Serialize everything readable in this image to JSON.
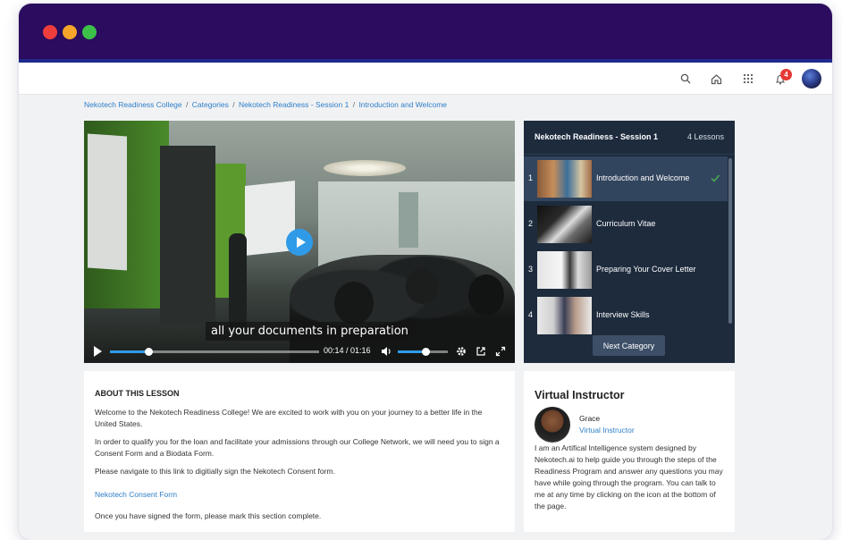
{
  "breadcrumb": {
    "items": [
      "Nekotech Readiness College",
      "Categories",
      "Nekotech Readiness - Session 1",
      "Introduction and Welcome"
    ],
    "separator": "/"
  },
  "navbar": {
    "icons": [
      "search-icon",
      "home-icon",
      "apps-grid-icon",
      "bell-icon"
    ],
    "notification_count": "4"
  },
  "video": {
    "caption": "all your documents in preparation",
    "time": "00:14 / 01:16",
    "progress": 0.184,
    "volume": 0.55
  },
  "lessons": {
    "title": "Nekotech Readiness - Session 1",
    "count": "4 Lessons",
    "items": [
      {
        "num": "1",
        "title": "Introduction and Welcome",
        "completed": true
      },
      {
        "num": "2",
        "title": "Curriculum Vitae",
        "completed": false
      },
      {
        "num": "3",
        "title": "Preparing Your Cover Letter",
        "completed": false
      },
      {
        "num": "4",
        "title": "Interview Skills",
        "completed": false
      }
    ],
    "next_label": "Next Category"
  },
  "about": {
    "title": "ABOUT THIS LESSON",
    "p1": "Welcome to the Nekotech Readiness College! We are excited to work with you on your journey to a better life in the United States.",
    "p2": "In order to qualify you for the loan and facilitate your admissions through our College Network, we will need you to sign a Consent Form and a Biodata Form.",
    "p3": "Please navigate to this link to digitially sign the Nekotech Consent form.",
    "link": "Nekotech Consent Form",
    "p4": "Once you have signed the form, please mark this section complete."
  },
  "instructor": {
    "title": "Virtual Instructor",
    "name": "Grace",
    "role": "Virtual Instructor",
    "bio": "I am an Artifical Intelligence system designed by Nekotech.ai to help guide you through the steps of the Readiness Program and answer any questions you may have while going through the program. You can talk to me at any time by clicking on the icon at the bottom of the page."
  },
  "colors": {
    "titlebar": "#2b0c5e",
    "accent": "#2f9be8",
    "link": "#2f7fc8",
    "sidebar": "#1d2b3d"
  }
}
